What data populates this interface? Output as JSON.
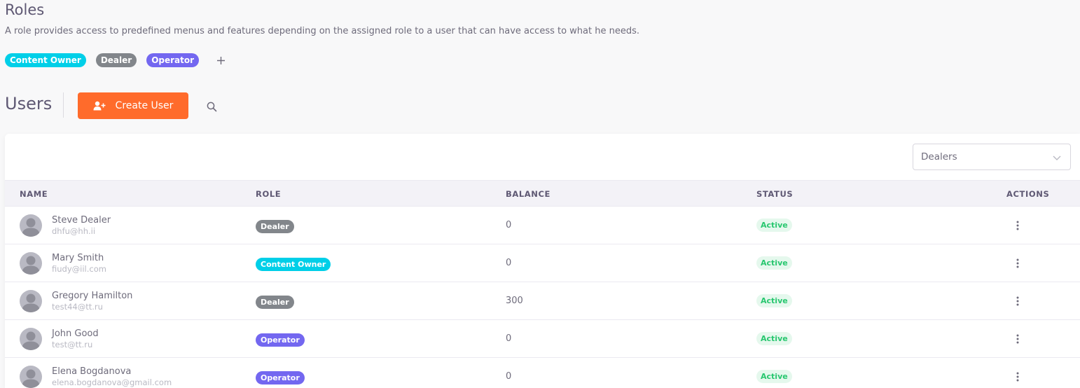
{
  "roles": {
    "title": "Roles",
    "description": "A role provides access to predefined menus and features depending on the assigned role to a user that can have access to what he needs.",
    "chips": [
      {
        "label": "Content Owner",
        "color": "#00cfe8"
      },
      {
        "label": "Dealer",
        "color": "#82868b"
      },
      {
        "label": "Operator",
        "color": "#7367f0"
      }
    ],
    "add_icon": "plus-icon"
  },
  "users": {
    "title": "Users",
    "create_label": "Create User",
    "create_icon": "user-plus-icon",
    "create_color": "#ff6b2b",
    "search_icon": "search-icon"
  },
  "filter": {
    "selected": "Dealers"
  },
  "table": {
    "headers": {
      "name": "NAME",
      "role": "ROLE",
      "balance": "BALANCE",
      "status": "STATUS",
      "actions": "ACTIONS"
    },
    "rows": [
      {
        "name": "Steve Dealer",
        "email": "dhfu@hh.ii",
        "role": "Dealer",
        "role_color": "#82868b",
        "balance": "0",
        "status": "Active"
      },
      {
        "name": "Mary Smith",
        "email": "fiudy@iil.com",
        "role": "Content Owner",
        "role_color": "#00cfe8",
        "balance": "0",
        "status": "Active"
      },
      {
        "name": "Gregory Hamilton",
        "email": "test44@tt.ru",
        "role": "Dealer",
        "role_color": "#82868b",
        "balance": "300",
        "status": "Active"
      },
      {
        "name": "John Good",
        "email": "test@tt.ru",
        "role": "Operator",
        "role_color": "#7367f0",
        "balance": "0",
        "status": "Active"
      },
      {
        "name": "Elena Bogdanova",
        "email": "elena.bogdanova@gmail.com",
        "role": "Operator",
        "role_color": "#7367f0",
        "balance": "0",
        "status": "Active"
      }
    ]
  },
  "colors": {
    "status_active_bg": "#e5f8ed",
    "status_active_fg": "#28c76f"
  }
}
